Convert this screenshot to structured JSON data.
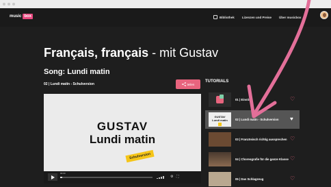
{
  "nav": {
    "logo_text": "music",
    "logo_box": "box",
    "links": [
      "Bibliothek",
      "Lizenzen und Preise",
      "Über musicbox"
    ]
  },
  "page": {
    "title_bold": "Français, français",
    "title_rest": " - mit Gustav",
    "song_title": "Song: Lundi matin",
    "subtitle": "02 | Lundi matin - Schulversion",
    "share_label": "teilen"
  },
  "video": {
    "line1": "GUSTAV",
    "line2": "Lundi matin",
    "tag": "Schulversion",
    "progress": 0.02,
    "time": "00:00"
  },
  "tutorials": {
    "heading": "TUTORIALS",
    "items": [
      {
        "label": "01 | Einstieg"
      },
      {
        "label": "02 | Lundi matin - Schulversion",
        "active": true
      },
      {
        "label": "03 | Französisch richtig aussprechen"
      },
      {
        "label": "04 | Choreografie für die ganze Klasse"
      },
      {
        "label": "05 | Das Schlagzeug"
      }
    ]
  },
  "colors": {
    "accent": "#e8647e",
    "background": "#1e1e1e",
    "tag_yellow": "#f5c518"
  }
}
